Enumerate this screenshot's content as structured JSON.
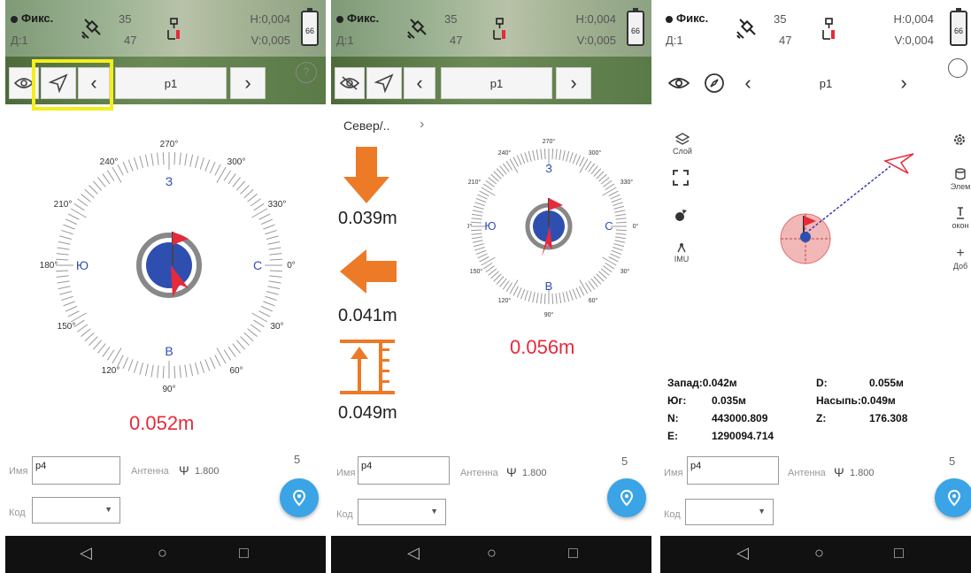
{
  "status": {
    "fix_label": "Фикс.",
    "age_label": "Д:1",
    "sat_used": "35",
    "sat_total": "47",
    "h_accuracy": "H:0,004",
    "v_accuracy": "V:0,005",
    "v_accuracy_p3": "V:0,004",
    "battery": "66"
  },
  "nav": {
    "point_name": "p1",
    "prev_glyph": "‹",
    "next_glyph": "›"
  },
  "compass": {
    "degree_labels": [
      "270°",
      "300°",
      "330°",
      "0°",
      "30°",
      "60°",
      "90°",
      "120°",
      "150°",
      "180°",
      "210°",
      "240°"
    ],
    "cardinals": {
      "west": "З",
      "east": "В",
      "south": "Ю",
      "north": "С"
    }
  },
  "panel1": {
    "distance": "0.052m"
  },
  "panel2": {
    "mode_label": "Север/..",
    "mode_chevron": "›",
    "north_south_offset": "0.039m",
    "east_west_offset": "0.041m",
    "fill_offset": "0.049m",
    "distance": "0.056m"
  },
  "panel3": {
    "layers_label": "Слой",
    "imu_label": "IMU",
    "element_label": "Элем",
    "tool_label": "окон",
    "add_label": "Доб",
    "west_label": "Запад:0.042м",
    "south_label": "Юг:",
    "south_value": "0.035м",
    "n_label": "N:",
    "n_value": "443000.809",
    "e_label": "E:",
    "e_value": "1290094.714",
    "d_label": "D:",
    "d_value": "0.055м",
    "fill_label": "Насыпь:0.049м",
    "z_label": "Z:",
    "z_value": "176.308"
  },
  "form": {
    "name_label": "Имя",
    "name_value": "p4",
    "antenna_label": "Антенна",
    "antenna_height": "1.800",
    "code_label": "Код",
    "code_value": "",
    "count": "5"
  },
  "sysbar": {
    "back": "◁",
    "home": "○",
    "recents": "□"
  },
  "colors": {
    "accent": "#3aa4e6",
    "distance": "#e8293a",
    "pointer": "#e8293a",
    "target": "#2f4fb0",
    "arrow": "#ec7a27"
  }
}
